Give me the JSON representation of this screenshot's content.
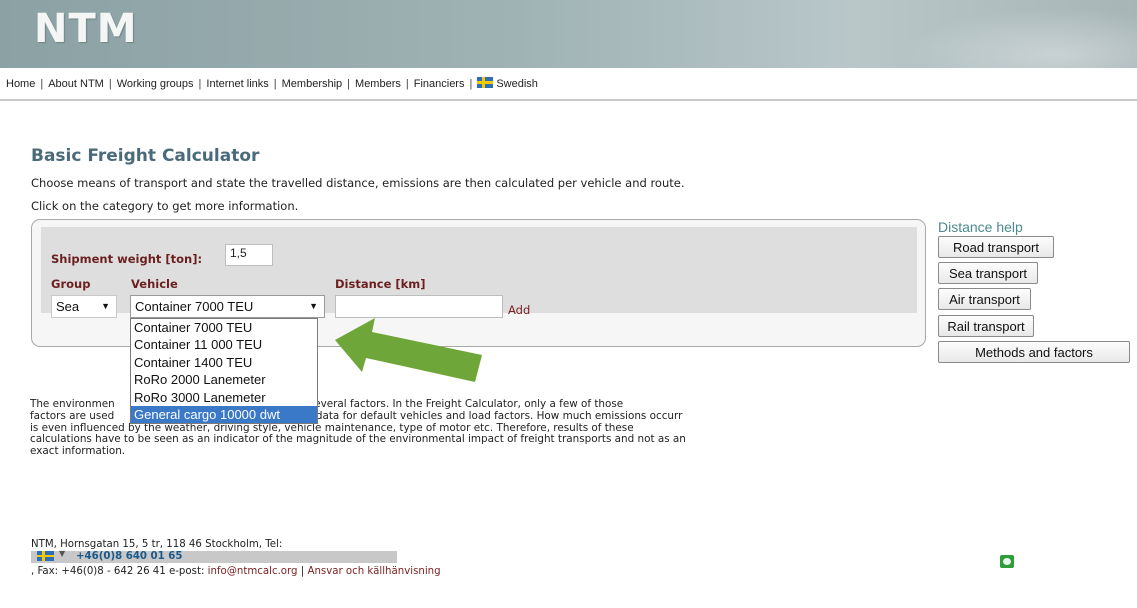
{
  "header": {
    "logo": "NTM"
  },
  "nav": {
    "items": [
      "Home",
      "About NTM",
      "Working groups",
      "Internet links",
      "Membership",
      "Members",
      "Financiers"
    ],
    "separator": "|",
    "language": "Swedish"
  },
  "page": {
    "title": "Basic Freight Calculator",
    "intro1": "Choose means of transport and state the travelled distance, emissions are then calculated per vehicle and route.",
    "intro2": "Click on the category to get more information."
  },
  "form": {
    "weight_label": "Shipment weight [ton]:",
    "weight_value": "1,5",
    "group_label": "Group",
    "group_value": "Sea",
    "vehicle_label": "Vehicle",
    "vehicle_value": "Container 7000 TEU",
    "distance_label": "Distance [km]",
    "distance_value": "",
    "add_label": "Add",
    "vehicle_options": [
      "Container 7000 TEU",
      "Container 11 000 TEU",
      "Container 1400 TEU",
      "RoRo 2000 Lanemeter",
      "RoRo 3000 Lanemeter",
      "General cargo 10000 dwt"
    ],
    "highlighted_option": "General cargo 10000 dwt"
  },
  "description": {
    "line1_a": "The environmen",
    "line1_b": "is determined by several factors. In the Freight Calculator, only a few of those",
    "line2_a": "factors are used",
    "line2_b": "scientifc data for default vehicles and load factors. How much emissions occurr",
    "line3": "is even influenced by the weather, driving style, vehicle maintenance, type of motor etc. Therefore, results of these",
    "line4": "calculations have to be seen as an indicator of the magnitude of the environmental impact of freight transports and not as an",
    "line5": "exact information."
  },
  "sidebar": {
    "title": "Distance help",
    "buttons": [
      "Road transport",
      "Sea transport",
      "Air transport",
      "Rail transport",
      "Methods and factors"
    ]
  },
  "footer": {
    "address": "NTM, Hornsgatan 15, 5 tr, 118 46 Stockholm, Tel:",
    "phone": "+46(0)8 640 01 65",
    "fax": ", Fax: +46(0)8 - 642 26 41 e-post:",
    "email": "info@ntmcalc.org",
    "sep": "|",
    "link": "Ansvar och källhänvisning"
  },
  "colors": {
    "title": "#4b6b7a",
    "label": "#6b1f1f",
    "highlight": "#3a78c8",
    "arrow": "#6fa63a"
  }
}
